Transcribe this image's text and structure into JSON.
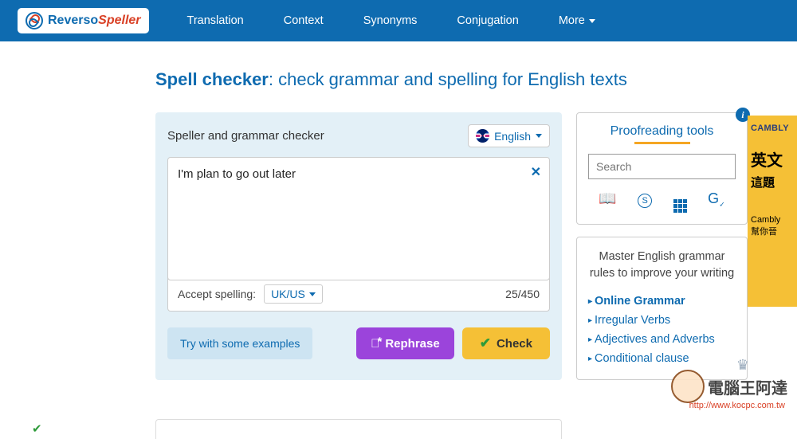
{
  "header": {
    "logo_part1": "Reverso",
    "logo_part2": "Speller",
    "nav": [
      "Translation",
      "Context",
      "Synonyms",
      "Conjugation",
      "More"
    ]
  },
  "title": {
    "bold": "Spell checker",
    "rest": ": check grammar and spelling for English texts"
  },
  "card": {
    "title": "Speller and grammar checker",
    "language": "English",
    "text": "I'm plan to go out later",
    "accept_label": "Accept spelling:",
    "accept_value": "UK/US",
    "counter": "25/450",
    "examples_btn": "Try with some examples",
    "rephrase_btn": "Rephrase",
    "check_btn": "Check"
  },
  "sidebar": {
    "proof_title": "Proofreading tools",
    "search_placeholder": "Search",
    "grammar_text": "Master English grammar rules to improve your writing",
    "links": [
      "Online Grammar",
      "Irregular Verbs",
      "Adjectives and Adverbs",
      "Conditional clause"
    ]
  },
  "ad": {
    "brand": "CAMBLY",
    "line1": "英文",
    "line2": "這題",
    "line3": "Cambly",
    "line4": "幫你晉"
  },
  "watermark": {
    "text": "電腦王阿達",
    "url": "http://www.kocpc.com.tw"
  }
}
